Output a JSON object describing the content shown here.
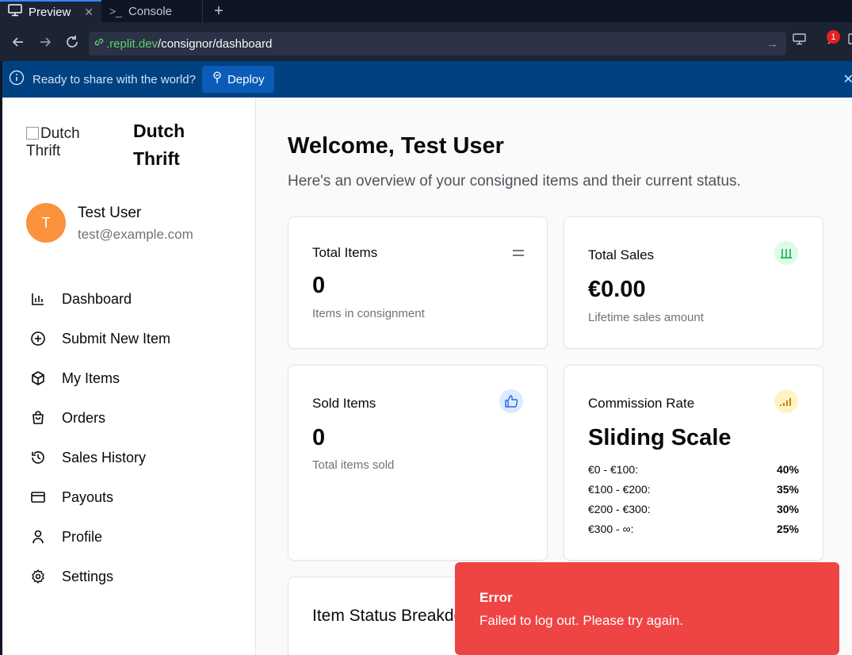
{
  "ide": {
    "tabs": [
      {
        "label": "Preview",
        "icon": "monitor-icon",
        "active": true
      },
      {
        "label": "Console",
        "icon": "terminal-icon",
        "active": false
      }
    ],
    "url": {
      "domain": ".replit.dev",
      "path": "/consignor/dashboard"
    },
    "notification_count": "1",
    "deploy_banner": {
      "message": "Ready to share with the world?",
      "button": "Deploy"
    }
  },
  "sidebar": {
    "logo_alt": "Dutch Thrift",
    "brand": "Dutch Thrift",
    "user": {
      "initial": "T",
      "name": "Test User",
      "email": "test@example.com"
    },
    "nav": [
      {
        "label": "Dashboard",
        "icon": "bar-chart-icon"
      },
      {
        "label": "Submit New Item",
        "icon": "plus-circle-icon"
      },
      {
        "label": "My Items",
        "icon": "package-icon"
      },
      {
        "label": "Orders",
        "icon": "shopping-bag-icon"
      },
      {
        "label": "Sales History",
        "icon": "history-icon"
      },
      {
        "label": "Payouts",
        "icon": "credit-card-icon"
      },
      {
        "label": "Profile",
        "icon": "user-icon"
      },
      {
        "label": "Settings",
        "icon": "gear-icon"
      }
    ]
  },
  "main": {
    "heading": "Welcome, Test User",
    "subtitle": "Here's an overview of your consigned items and their current status.",
    "cards": {
      "total_items": {
        "title": "Total Items",
        "value": "0",
        "desc": "Items in consignment"
      },
      "total_sales": {
        "title": "Total Sales",
        "value": "€0.00",
        "desc": "Lifetime sales amount"
      },
      "sold_items": {
        "title": "Sold Items",
        "value": "0",
        "desc": "Total items sold"
      },
      "commission": {
        "title": "Commission Rate",
        "value": "Sliding Scale",
        "tiers": [
          {
            "range": "€0 - €100:",
            "rate": "40%"
          },
          {
            "range": "€100 - €200:",
            "rate": "35%"
          },
          {
            "range": "€200 - €300:",
            "rate": "30%"
          },
          {
            "range": "€300 - ∞:",
            "rate": "25%"
          }
        ]
      },
      "status_breakdown": {
        "title": "Item Status Breakdown"
      }
    }
  },
  "toast": {
    "title": "Error",
    "message": "Failed to log out. Please try again."
  },
  "colors": {
    "accent_orange": "#fb923c",
    "toast_red": "#ef4444",
    "deploy_blue": "#004182"
  }
}
